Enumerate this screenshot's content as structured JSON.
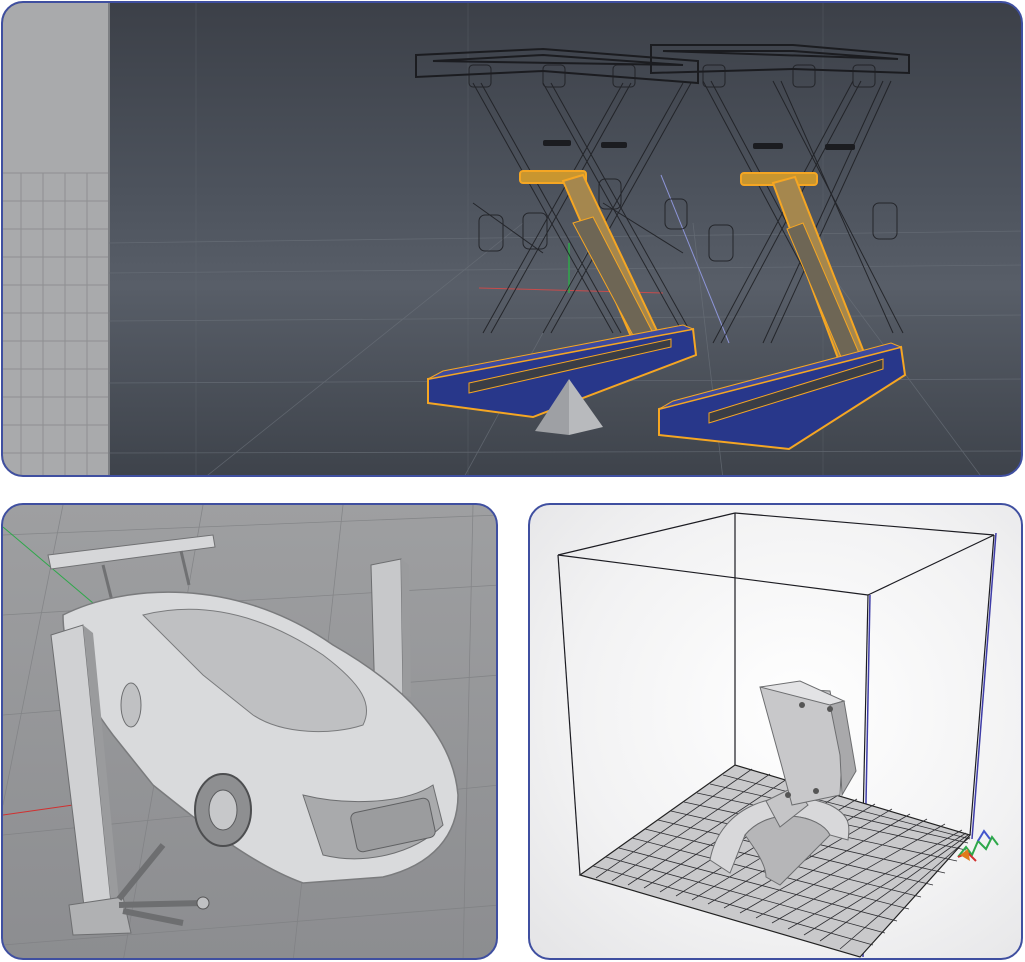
{
  "figure": {
    "panels": [
      {
        "id": "top",
        "subject": "scissor-lift-wireframe-viewport"
      },
      {
        "id": "bottom-left",
        "subject": "car-on-two-post-lift-render"
      },
      {
        "id": "bottom-right",
        "subject": "3d-print-build-volume-preview"
      }
    ],
    "colors": {
      "panel_border": "#3f4fa0",
      "selection_orange": "#f5a623",
      "lift_base_blue": "#28378a",
      "viewport_dark": "#4a4f58",
      "axis_green": "#2ea84a",
      "axis_red": "#d13030",
      "axis_blue": "#4455cc"
    },
    "icons": [
      "axis-gizmo-icon",
      "print-bed-grid",
      "build-volume-box"
    ]
  }
}
